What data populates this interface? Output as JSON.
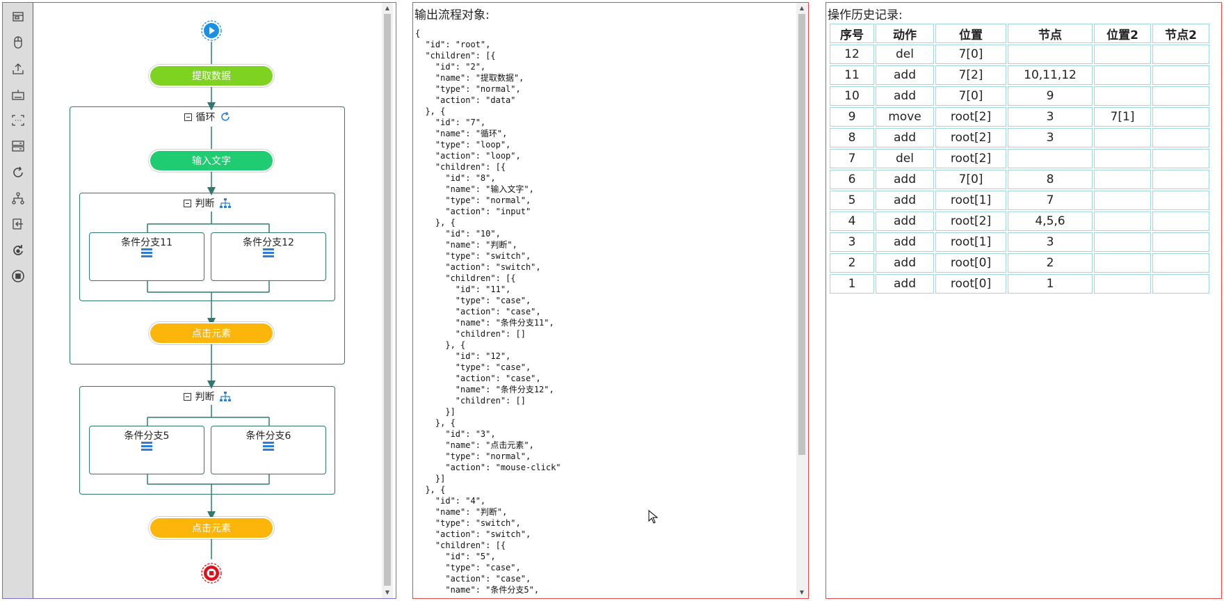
{
  "flow": {
    "start_node": "start",
    "nodes": {
      "extract": "提取数据",
      "input_text": "输入文字",
      "click1": "点击元素",
      "click2": "点击元素"
    },
    "loop_title": "循环",
    "switch1_title": "判断",
    "switch2_title": "判断",
    "cases": {
      "c11": "条件分支11",
      "c12": "条件分支12",
      "c5": "条件分支5",
      "c6": "条件分支6"
    },
    "colors": {
      "green1": "#7ed321",
      "green2": "#1fcc72",
      "orange": "#fbb50b",
      "start": "#1a8fe3",
      "end": "#e0101a",
      "line": "#2f7a6e"
    }
  },
  "toolbar_icons": [
    "window-icon",
    "mouse-icon",
    "upload-icon",
    "keyboard-icon",
    "input-box-icon",
    "data-table-icon",
    "loop-icon",
    "branch-icon",
    "exit-icon",
    "refresh-icon",
    "stop-icon"
  ],
  "json_panel": {
    "title": "输出流程对象:",
    "content": "{\n  \"id\": \"root\",\n  \"children\": [{\n    \"id\": \"2\",\n    \"name\": \"提取数据\",\n    \"type\": \"normal\",\n    \"action\": \"data\"\n  }, {\n    \"id\": \"7\",\n    \"name\": \"循环\",\n    \"type\": \"loop\",\n    \"action\": \"loop\",\n    \"children\": [{\n      \"id\": \"8\",\n      \"name\": \"输入文字\",\n      \"type\": \"normal\",\n      \"action\": \"input\"\n    }, {\n      \"id\": \"10\",\n      \"name\": \"判断\",\n      \"type\": \"switch\",\n      \"action\": \"switch\",\n      \"children\": [{\n        \"id\": \"11\",\n        \"type\": \"case\",\n        \"action\": \"case\",\n        \"name\": \"条件分支11\",\n        \"children\": []\n      }, {\n        \"id\": \"12\",\n        \"type\": \"case\",\n        \"action\": \"case\",\n        \"name\": \"条件分支12\",\n        \"children\": []\n      }]\n    }, {\n      \"id\": \"3\",\n      \"name\": \"点击元素\",\n      \"type\": \"normal\",\n      \"action\": \"mouse-click\"\n    }]\n  }, {\n    \"id\": \"4\",\n    \"name\": \"判断\",\n    \"type\": \"switch\",\n    \"action\": \"switch\",\n    \"children\": [{\n      \"id\": \"5\",\n      \"type\": \"case\",\n      \"action\": \"case\",\n      \"name\": \"条件分支5\","
  },
  "history_panel": {
    "title": "操作历史记录:",
    "headers": [
      "序号",
      "动作",
      "位置",
      "节点",
      "位置2",
      "节点2"
    ],
    "rows": [
      [
        "12",
        "del",
        "7[0]",
        "",
        "",
        ""
      ],
      [
        "11",
        "add",
        "7[2]",
        "10,11,12",
        "",
        ""
      ],
      [
        "10",
        "add",
        "7[0]",
        "9",
        "",
        ""
      ],
      [
        "9",
        "move",
        "root[2]",
        "3",
        "7[1]",
        ""
      ],
      [
        "8",
        "add",
        "root[2]",
        "3",
        "",
        ""
      ],
      [
        "7",
        "del",
        "root[2]",
        "",
        "",
        ""
      ],
      [
        "6",
        "add",
        "7[0]",
        "8",
        "",
        ""
      ],
      [
        "5",
        "add",
        "root[1]",
        "7",
        "",
        ""
      ],
      [
        "4",
        "add",
        "root[2]",
        "4,5,6",
        "",
        ""
      ],
      [
        "3",
        "add",
        "root[1]",
        "3",
        "",
        ""
      ],
      [
        "2",
        "add",
        "root[0]",
        "2",
        "",
        ""
      ],
      [
        "1",
        "add",
        "root[0]",
        "1",
        "",
        ""
      ]
    ]
  }
}
